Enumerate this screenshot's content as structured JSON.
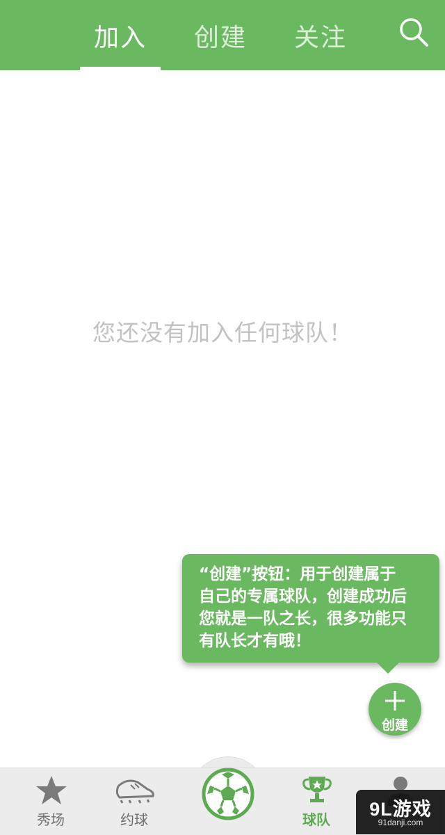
{
  "colors": {
    "brand_green": "#6ab860",
    "empty_text": "#c2c2c2",
    "nav_bg": "#ececec",
    "nav_inactive": "#6e6e6e",
    "nav_active": "#5daa52"
  },
  "top_tabs": {
    "items": [
      {
        "label": "加入",
        "active": true
      },
      {
        "label": "创建",
        "active": false
      },
      {
        "label": "关注",
        "active": false
      }
    ],
    "search_icon": "search-icon"
  },
  "main": {
    "empty_message": "您还没有加入任何球队！"
  },
  "tooltip": {
    "lines": [
      "“创建”按钮：用于创建属于",
      "自己的专属球队，创建成功后",
      "您就是一队之长，很多功能只",
      "有队长才有哦！"
    ]
  },
  "fab": {
    "icon": "plus-icon",
    "label": "创建"
  },
  "bottom_nav": {
    "items": [
      {
        "label": "秀场",
        "icon": "star-icon",
        "active": false
      },
      {
        "label": "约球",
        "icon": "football-boot-icon",
        "active": false
      },
      {
        "label": "",
        "icon": "soccer-ball-icon",
        "active": false
      },
      {
        "label": "球队",
        "icon": "trophy-icon",
        "active": true
      },
      {
        "label": "",
        "icon": "user-icon",
        "active": false
      }
    ]
  },
  "watermark": {
    "main": "9L游戏",
    "sub": "91danji.com"
  }
}
